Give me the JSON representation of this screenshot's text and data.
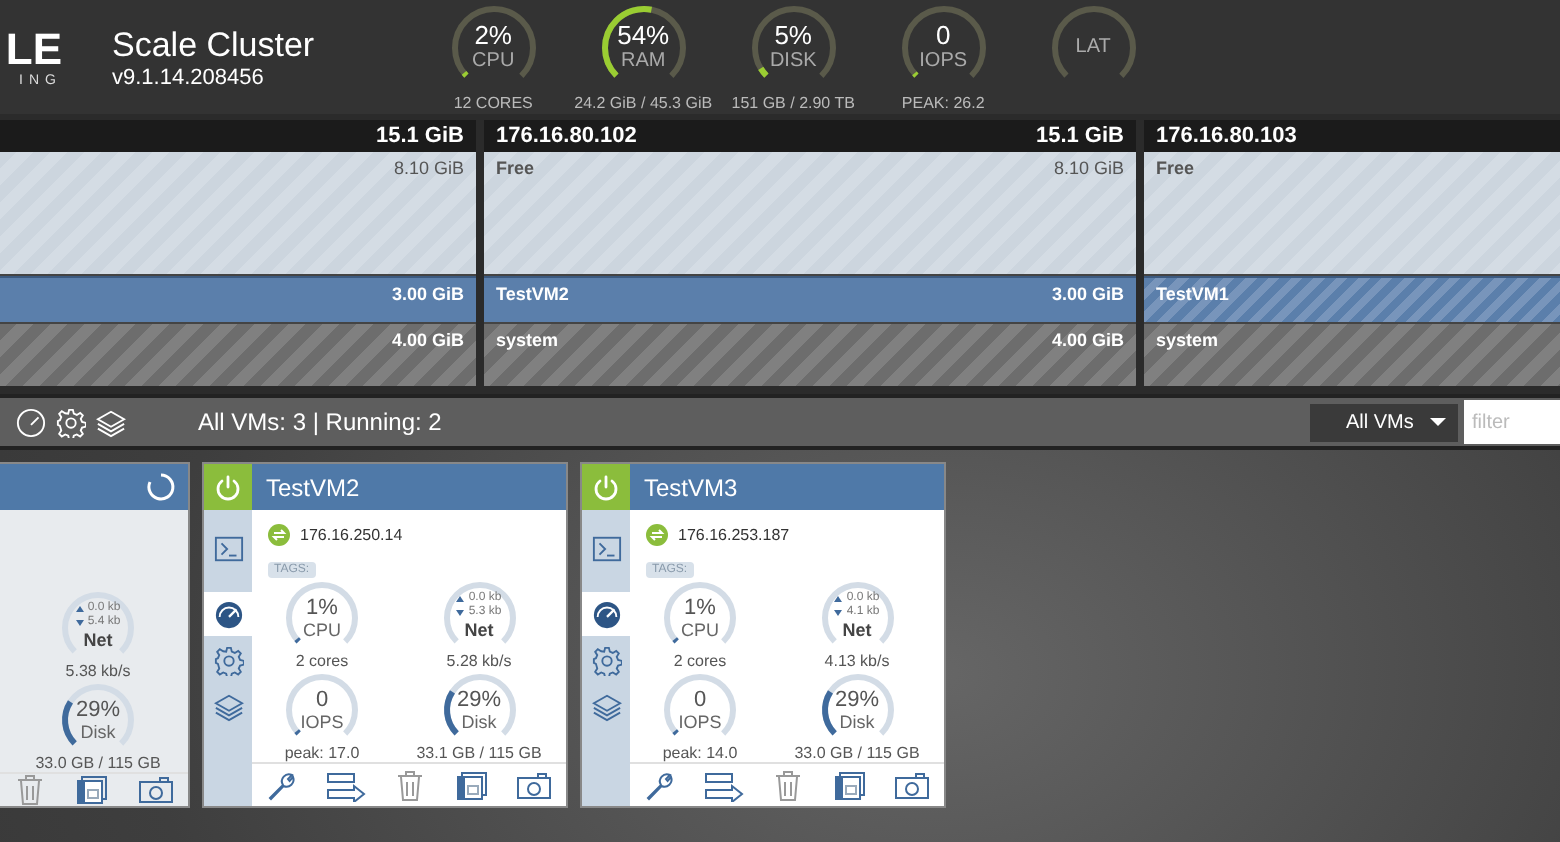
{
  "header": {
    "logo": {
      "mark": "LE",
      "tagline": "ING"
    },
    "title": "Scale Cluster",
    "version": "v9.1.14.208456",
    "gauges": [
      {
        "value": "2%",
        "label": "CPU",
        "caption": "12 CORES",
        "level": 0.02
      },
      {
        "value": "54%",
        "label": "RAM",
        "caption": "24.2 GiB / 45.3 GiB",
        "level": 0.54
      },
      {
        "value": "5%",
        "label": "DISK",
        "caption": "151 GB / 2.90 TB",
        "level": 0.05
      },
      {
        "value": "0",
        "label": "IOPS",
        "caption": "PEAK: 26.2",
        "level": 0
      },
      {
        "label": "LAT"
      }
    ]
  },
  "nodes": [
    {
      "total": "15.1 GiB",
      "segments": [
        {
          "kind": "free",
          "size": "8.10 GiB"
        },
        {
          "kind": "vm",
          "size": "3.00 GiB",
          "running": true
        },
        {
          "kind": "system",
          "size": "4.00 GiB"
        }
      ]
    },
    {
      "ip": "176.16.80.102",
      "total": "15.1 GiB",
      "segments": [
        {
          "kind": "free",
          "label": "Free",
          "size": "8.10 GiB"
        },
        {
          "kind": "vm",
          "label": "TestVM2",
          "size": "3.00 GiB",
          "running": true
        },
        {
          "kind": "system",
          "label": "system",
          "size": "4.00 GiB"
        }
      ]
    },
    {
      "ip": "176.16.80.103",
      "segments": [
        {
          "kind": "free",
          "label": "Free"
        },
        {
          "kind": "vm",
          "label": "TestVM1",
          "running": false
        },
        {
          "kind": "system",
          "label": "system"
        }
      ]
    }
  ],
  "toolbar": {
    "summary": "All VMs: 3 | Running: 2",
    "select": "All VMs",
    "filter_placeholder": "filter"
  },
  "vms": [
    {
      "busy": true,
      "gauges": [
        {
          "kind": "net",
          "up": "0.0 kb",
          "down": "5.4 kb",
          "label": "Net",
          "caption": "5.38 kb/s"
        },
        {
          "kind": "ring",
          "value": "29%",
          "label": "Disk",
          "caption": "33.0 GB / 115 GB",
          "level": 0.29
        }
      ],
      "actions": [
        {
          "kind": "delete"
        },
        {
          "kind": "schedule"
        },
        {
          "kind": "snapshot"
        }
      ]
    },
    {
      "name": "TestVM2",
      "on": true,
      "busy": false,
      "ip": "176.16.250.14",
      "tags_label": "TAGS:",
      "sidebar": [
        {
          "kind": "console",
          "selected": false
        },
        {
          "kind": "stats",
          "selected": true
        },
        {
          "kind": "settings",
          "selected": false
        },
        {
          "kind": "snapshots",
          "selected": false
        }
      ],
      "gauges": [
        {
          "kind": "ring",
          "value": "1%",
          "label": "CPU",
          "caption": "2 cores",
          "level": 0.01
        },
        {
          "kind": "net",
          "up": "0.0 kb",
          "down": "5.3 kb",
          "label": "Net",
          "caption": "5.28 kb/s"
        },
        {
          "kind": "ring",
          "value": "0",
          "label": "IOPS",
          "caption": "peak: 17.0",
          "level": 0
        },
        {
          "kind": "ring",
          "value": "29%",
          "label": "Disk",
          "caption": "33.1 GB / 115 GB",
          "level": 0.29
        }
      ],
      "actions": [
        {
          "kind": "settings"
        },
        {
          "kind": "migrate"
        },
        {
          "kind": "delete"
        },
        {
          "kind": "schedule"
        },
        {
          "kind": "snapshot"
        }
      ]
    },
    {
      "name": "TestVM3",
      "on": true,
      "busy": false,
      "ip": "176.16.253.187",
      "tags_label": "TAGS:",
      "sidebar": [
        {
          "kind": "console",
          "selected": false
        },
        {
          "kind": "stats",
          "selected": true
        },
        {
          "kind": "settings",
          "selected": false
        },
        {
          "kind": "snapshots",
          "selected": false
        }
      ],
      "gauges": [
        {
          "kind": "ring",
          "value": "1%",
          "label": "CPU",
          "caption": "2 cores",
          "level": 0.01
        },
        {
          "kind": "net",
          "up": "0.0 kb",
          "down": "4.1 kb",
          "label": "Net",
          "caption": "4.13 kb/s"
        },
        {
          "kind": "ring",
          "value": "0",
          "label": "IOPS",
          "caption": "peak: 14.0",
          "level": 0
        },
        {
          "kind": "ring",
          "value": "29%",
          "label": "Disk",
          "caption": "33.0 GB / 115 GB",
          "level": 0.29
        }
      ],
      "actions": [
        {
          "kind": "settings"
        },
        {
          "kind": "migrate"
        },
        {
          "kind": "delete"
        },
        {
          "kind": "schedule"
        },
        {
          "kind": "snapshot"
        }
      ]
    }
  ]
}
